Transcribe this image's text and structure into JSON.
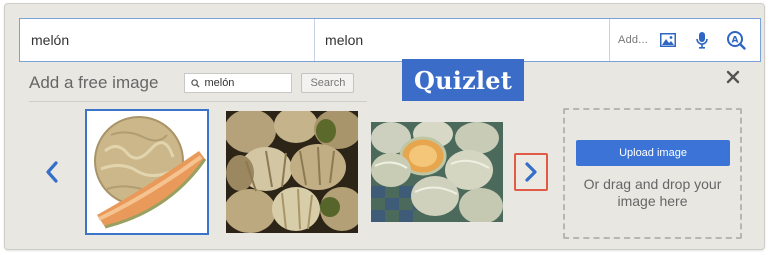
{
  "term": {
    "value": "melón"
  },
  "definition": {
    "value": "melon"
  },
  "tools": {
    "add_label": "Add..."
  },
  "panel": {
    "title": "Add a free image",
    "search_value": "melón",
    "search_button": "Search"
  },
  "brand": {
    "logo_text": "Quizlet"
  },
  "upload": {
    "button_label": "Upload image",
    "hint": "Or drag and drop your image here"
  },
  "colors": {
    "accent": "#3b74d6",
    "brand": "#3a6cc8",
    "highlight": "#e05a48"
  },
  "icons": [
    "image-icon",
    "microphone-icon",
    "language-search-icon",
    "magnifier-icon",
    "close-icon",
    "chevron-left-icon",
    "chevron-right-icon"
  ]
}
